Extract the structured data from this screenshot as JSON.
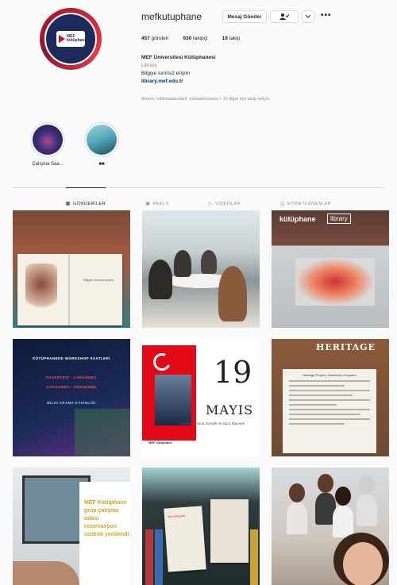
{
  "profile": {
    "username": "mefkutuphane",
    "buttons": {
      "message": "Mesaj Gönder",
      "follow_icon": "person-check-icon",
      "dropdown_icon": "chevron-down-icon",
      "more": "•••"
    },
    "stats": [
      {
        "count": "457",
        "label": "gönderi"
      },
      {
        "count": "930",
        "label": "takipçi"
      },
      {
        "count": "19",
        "label": "takip"
      }
    ],
    "bio": {
      "name": "MEF Üniversitesi Kütüphanesi",
      "category": "Library",
      "line": "Bilgiye sınırsız erişim",
      "link": "library.mef.edu.tr"
    },
    "followed_by": "dinemi, hdikstatabulaeli, tunbatbicomna + 16 diğer kişi takip ediyor"
  },
  "highlights": [
    {
      "label": "Çalışma Saa..."
    },
    {
      "label": "■■"
    }
  ],
  "tabs": [
    {
      "icon": "grid-icon",
      "label": "GÖNDERİLER",
      "active": true
    },
    {
      "icon": "reels-icon",
      "label": "REELS",
      "active": false
    },
    {
      "icon": "video-icon",
      "label": "VİDEOLAR",
      "active": false
    },
    {
      "icon": "tag-icon",
      "label": "ETİKETLENENLER",
      "active": false
    }
  ],
  "posts": {
    "p1_text": "Bilgiye sınırsız erişim",
    "p3_sign": "kütüphane",
    "p3_sign2": "library",
    "p4_lines": [
      "KÜTÜPHANEDE WORKSHOP SAATLERİ",
      "PAZARTESİ - ÇARŞAMBA",
      "ÇARŞAMBA - PERŞEMBE",
      "BİLGİ ARAMA ETKİNLİĞİ"
    ],
    "p5_num": "19",
    "p5_month": "MAYIS",
    "p5_sub": "Atatürk'ü Anma Gençlik ve Spor Bayramı",
    "p5_logo": "MEF kütüphane",
    "p6_title": "HERITAGE",
    "p6_doc": "Heritage Projesi • Workshop Programı",
    "p7_text": "MEF Kütüphane grup çalışma odası rezervasyon sistemi yenilendi",
    "p8_book": "Yeni Kitaplar"
  },
  "colors": {
    "accent_red": "#c8102e",
    "brand_navy": "#1f2a5c",
    "text_muted": "#8e8e8e",
    "link": "#00376b"
  }
}
